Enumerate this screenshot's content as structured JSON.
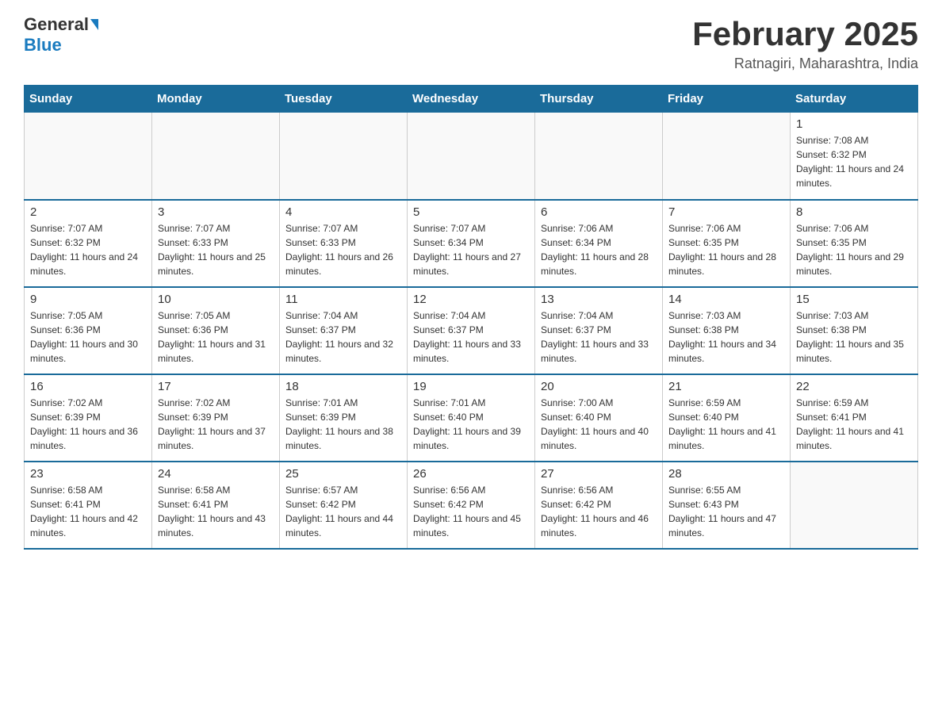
{
  "header": {
    "logo_general": "General",
    "logo_blue": "Blue",
    "month_title": "February 2025",
    "location": "Ratnagiri, Maharashtra, India"
  },
  "weekdays": [
    "Sunday",
    "Monday",
    "Tuesday",
    "Wednesday",
    "Thursday",
    "Friday",
    "Saturday"
  ],
  "weeks": [
    [
      {
        "day": "",
        "info": ""
      },
      {
        "day": "",
        "info": ""
      },
      {
        "day": "",
        "info": ""
      },
      {
        "day": "",
        "info": ""
      },
      {
        "day": "",
        "info": ""
      },
      {
        "day": "",
        "info": ""
      },
      {
        "day": "1",
        "info": "Sunrise: 7:08 AM\nSunset: 6:32 PM\nDaylight: 11 hours and 24 minutes."
      }
    ],
    [
      {
        "day": "2",
        "info": "Sunrise: 7:07 AM\nSunset: 6:32 PM\nDaylight: 11 hours and 24 minutes."
      },
      {
        "day": "3",
        "info": "Sunrise: 7:07 AM\nSunset: 6:33 PM\nDaylight: 11 hours and 25 minutes."
      },
      {
        "day": "4",
        "info": "Sunrise: 7:07 AM\nSunset: 6:33 PM\nDaylight: 11 hours and 26 minutes."
      },
      {
        "day": "5",
        "info": "Sunrise: 7:07 AM\nSunset: 6:34 PM\nDaylight: 11 hours and 27 minutes."
      },
      {
        "day": "6",
        "info": "Sunrise: 7:06 AM\nSunset: 6:34 PM\nDaylight: 11 hours and 28 minutes."
      },
      {
        "day": "7",
        "info": "Sunrise: 7:06 AM\nSunset: 6:35 PM\nDaylight: 11 hours and 28 minutes."
      },
      {
        "day": "8",
        "info": "Sunrise: 7:06 AM\nSunset: 6:35 PM\nDaylight: 11 hours and 29 minutes."
      }
    ],
    [
      {
        "day": "9",
        "info": "Sunrise: 7:05 AM\nSunset: 6:36 PM\nDaylight: 11 hours and 30 minutes."
      },
      {
        "day": "10",
        "info": "Sunrise: 7:05 AM\nSunset: 6:36 PM\nDaylight: 11 hours and 31 minutes."
      },
      {
        "day": "11",
        "info": "Sunrise: 7:04 AM\nSunset: 6:37 PM\nDaylight: 11 hours and 32 minutes."
      },
      {
        "day": "12",
        "info": "Sunrise: 7:04 AM\nSunset: 6:37 PM\nDaylight: 11 hours and 33 minutes."
      },
      {
        "day": "13",
        "info": "Sunrise: 7:04 AM\nSunset: 6:37 PM\nDaylight: 11 hours and 33 minutes."
      },
      {
        "day": "14",
        "info": "Sunrise: 7:03 AM\nSunset: 6:38 PM\nDaylight: 11 hours and 34 minutes."
      },
      {
        "day": "15",
        "info": "Sunrise: 7:03 AM\nSunset: 6:38 PM\nDaylight: 11 hours and 35 minutes."
      }
    ],
    [
      {
        "day": "16",
        "info": "Sunrise: 7:02 AM\nSunset: 6:39 PM\nDaylight: 11 hours and 36 minutes."
      },
      {
        "day": "17",
        "info": "Sunrise: 7:02 AM\nSunset: 6:39 PM\nDaylight: 11 hours and 37 minutes."
      },
      {
        "day": "18",
        "info": "Sunrise: 7:01 AM\nSunset: 6:39 PM\nDaylight: 11 hours and 38 minutes."
      },
      {
        "day": "19",
        "info": "Sunrise: 7:01 AM\nSunset: 6:40 PM\nDaylight: 11 hours and 39 minutes."
      },
      {
        "day": "20",
        "info": "Sunrise: 7:00 AM\nSunset: 6:40 PM\nDaylight: 11 hours and 40 minutes."
      },
      {
        "day": "21",
        "info": "Sunrise: 6:59 AM\nSunset: 6:40 PM\nDaylight: 11 hours and 41 minutes."
      },
      {
        "day": "22",
        "info": "Sunrise: 6:59 AM\nSunset: 6:41 PM\nDaylight: 11 hours and 41 minutes."
      }
    ],
    [
      {
        "day": "23",
        "info": "Sunrise: 6:58 AM\nSunset: 6:41 PM\nDaylight: 11 hours and 42 minutes."
      },
      {
        "day": "24",
        "info": "Sunrise: 6:58 AM\nSunset: 6:41 PM\nDaylight: 11 hours and 43 minutes."
      },
      {
        "day": "25",
        "info": "Sunrise: 6:57 AM\nSunset: 6:42 PM\nDaylight: 11 hours and 44 minutes."
      },
      {
        "day": "26",
        "info": "Sunrise: 6:56 AM\nSunset: 6:42 PM\nDaylight: 11 hours and 45 minutes."
      },
      {
        "day": "27",
        "info": "Sunrise: 6:56 AM\nSunset: 6:42 PM\nDaylight: 11 hours and 46 minutes."
      },
      {
        "day": "28",
        "info": "Sunrise: 6:55 AM\nSunset: 6:43 PM\nDaylight: 11 hours and 47 minutes."
      },
      {
        "day": "",
        "info": ""
      }
    ]
  ]
}
